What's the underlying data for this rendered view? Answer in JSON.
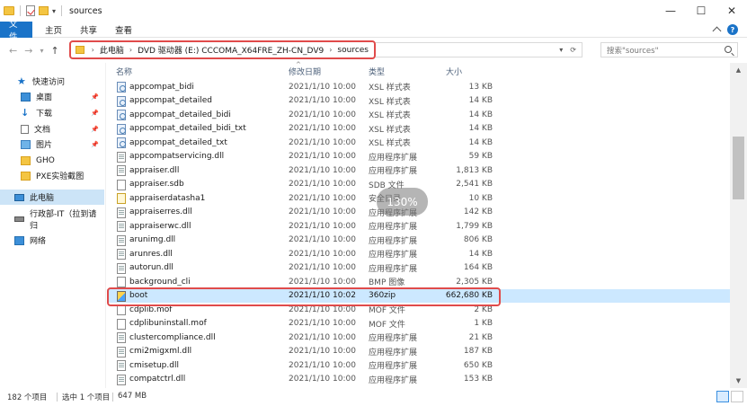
{
  "window": {
    "title": "sources",
    "controls": {
      "minimize": "—",
      "maximize": "☐",
      "close": "✕"
    }
  },
  "ribbon": {
    "tabs": [
      "文件",
      "主页",
      "共享",
      "查看"
    ]
  },
  "address": {
    "crumbs": [
      "此电脑",
      "DVD 驱动器 (E:) CCCOMA_X64FRE_ZH-CN_DV9",
      "sources"
    ],
    "search_placeholder": "搜索\"sources\""
  },
  "sidebar": {
    "items": [
      {
        "label": "快速访问",
        "icon": "star-icon"
      },
      {
        "label": "桌面",
        "icon": "desktop-icon",
        "pinned": true
      },
      {
        "label": "下载",
        "icon": "download-icon",
        "pinned": true
      },
      {
        "label": "文档",
        "icon": "document-icon",
        "pinned": true
      },
      {
        "label": "图片",
        "icon": "picture-icon",
        "pinned": true
      },
      {
        "label": "GHO",
        "icon": "folder-icon"
      },
      {
        "label": "PXE实验截图",
        "icon": "folder-icon"
      },
      {
        "label": "此电脑",
        "icon": "computer-icon",
        "selected": true
      },
      {
        "label": "行政部-IT（拉到请归",
        "icon": "drive-icon"
      },
      {
        "label": "网络",
        "icon": "network-icon"
      }
    ]
  },
  "columns": {
    "name": "名称",
    "date": "修改日期",
    "type": "类型",
    "size": "大小"
  },
  "files": [
    {
      "name": "appcompat_bidi",
      "date": "2021/1/10 10:00",
      "type": "XSL 样式表",
      "size": "13 KB",
      "kind": "xsl"
    },
    {
      "name": "appcompat_detailed",
      "date": "2021/1/10 10:00",
      "type": "XSL 样式表",
      "size": "14 KB",
      "kind": "xsl"
    },
    {
      "name": "appcompat_detailed_bidi",
      "date": "2021/1/10 10:00",
      "type": "XSL 样式表",
      "size": "14 KB",
      "kind": "xsl"
    },
    {
      "name": "appcompat_detailed_bidi_txt",
      "date": "2021/1/10 10:00",
      "type": "XSL 样式表",
      "size": "14 KB",
      "kind": "xsl"
    },
    {
      "name": "appcompat_detailed_txt",
      "date": "2021/1/10 10:00",
      "type": "XSL 样式表",
      "size": "14 KB",
      "kind": "xsl"
    },
    {
      "name": "appcompatservicing.dll",
      "date": "2021/1/10 10:00",
      "type": "应用程序扩展",
      "size": "59 KB",
      "kind": "dll"
    },
    {
      "name": "appraiser.dll",
      "date": "2021/1/10 10:00",
      "type": "应用程序扩展",
      "size": "1,813 KB",
      "kind": "dll"
    },
    {
      "name": "appraiser.sdb",
      "date": "2021/1/10 10:00",
      "type": "SDB 文件",
      "size": "2,541 KB",
      "kind": "file"
    },
    {
      "name": "appraiserdatasha1",
      "date": "2021/1/10 10:00",
      "type": "安全目录",
      "size": "10 KB",
      "kind": "cert"
    },
    {
      "name": "appraiserres.dll",
      "date": "2021/1/10 10:00",
      "type": "应用程序扩展",
      "size": "142 KB",
      "kind": "dll"
    },
    {
      "name": "appraiserwc.dll",
      "date": "2021/1/10 10:00",
      "type": "应用程序扩展",
      "size": "1,799 KB",
      "kind": "dll"
    },
    {
      "name": "arunimg.dll",
      "date": "2021/1/10 10:00",
      "type": "应用程序扩展",
      "size": "806 KB",
      "kind": "dll"
    },
    {
      "name": "arunres.dll",
      "date": "2021/1/10 10:00",
      "type": "应用程序扩展",
      "size": "14 KB",
      "kind": "dll"
    },
    {
      "name": "autorun.dll",
      "date": "2021/1/10 10:00",
      "type": "应用程序扩展",
      "size": "164 KB",
      "kind": "dll"
    },
    {
      "name": "background_cli",
      "date": "2021/1/10 10:00",
      "type": "BMP 图像",
      "size": "2,305 KB",
      "kind": "file"
    },
    {
      "name": "boot",
      "date": "2021/1/10 10:02",
      "type": "360zip",
      "size": "662,680 KB",
      "kind": "zip",
      "selected": true
    },
    {
      "name": "cdplib.mof",
      "date": "2021/1/10 10:00",
      "type": "MOF 文件",
      "size": "2 KB",
      "kind": "file"
    },
    {
      "name": "cdplibuninstall.mof",
      "date": "2021/1/10 10:00",
      "type": "MOF 文件",
      "size": "1 KB",
      "kind": "file"
    },
    {
      "name": "clustercompliance.dll",
      "date": "2021/1/10 10:00",
      "type": "应用程序扩展",
      "size": "21 KB",
      "kind": "dll"
    },
    {
      "name": "cmi2migxml.dll",
      "date": "2021/1/10 10:00",
      "type": "应用程序扩展",
      "size": "187 KB",
      "kind": "dll"
    },
    {
      "name": "cmisetup.dll",
      "date": "2021/1/10 10:00",
      "type": "应用程序扩展",
      "size": "650 KB",
      "kind": "dll"
    },
    {
      "name": "compatctrl.dll",
      "date": "2021/1/10 10:00",
      "type": "应用程序扩展",
      "size": "153 KB",
      "kind": "dll"
    }
  ],
  "zoom_overlay": "130%",
  "status": {
    "count": "182 个项目",
    "selected": "选中 1 个项目",
    "selected_size": "647 MB"
  },
  "colors": {
    "accent": "#1a73c8",
    "highlight_box": "#e04b4b",
    "selection": "#cce8ff"
  }
}
